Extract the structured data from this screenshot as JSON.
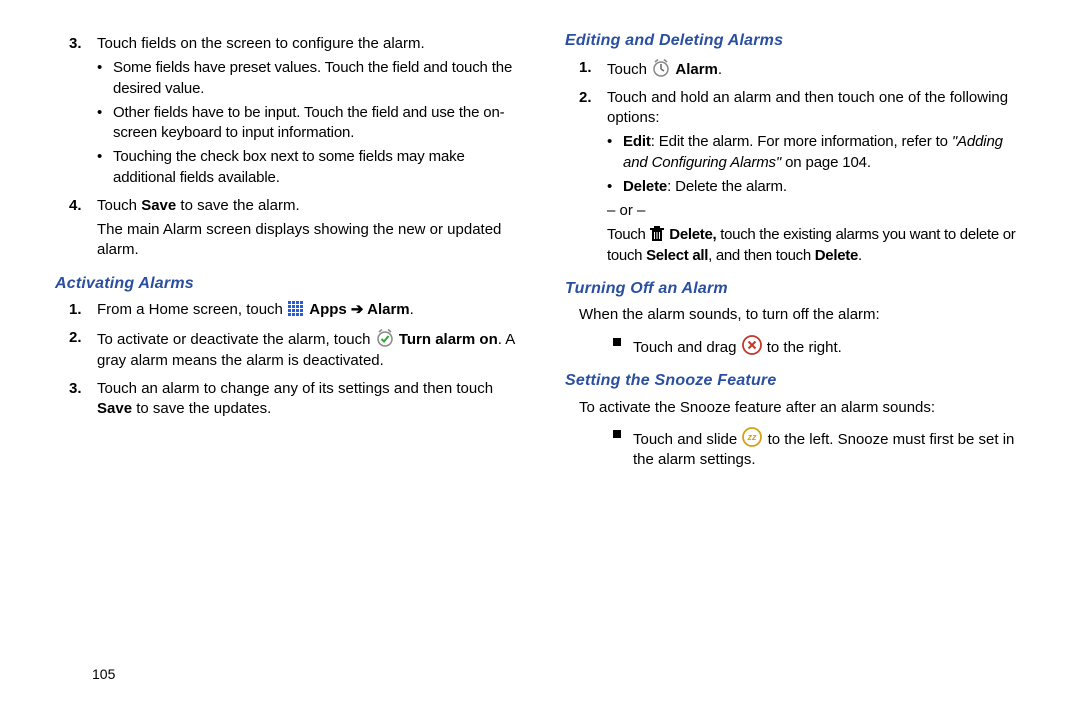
{
  "pageNumber": "105",
  "left": {
    "step3": {
      "num": "3.",
      "text": "Touch fields on the screen to configure the alarm.",
      "bullets": [
        "Some fields have preset values. Touch the field and touch the desired value.",
        "Other fields have to be input. Touch the field and use the on-screen keyboard to input information.",
        "Touching the check box next to some fields may make additional fields available."
      ]
    },
    "step4": {
      "num": "4.",
      "a": "Touch ",
      "save": "Save",
      "b": " to save the alarm.",
      "c": "The main Alarm screen displays showing the new or updated alarm."
    },
    "activating": {
      "heading": "Activating Alarms",
      "s1": {
        "num": "1.",
        "a": "From a Home screen, touch ",
        "apps": " Apps ",
        "arrow": "➔",
        "alarm": " Alarm",
        "dot": "."
      },
      "s2": {
        "num": "2.",
        "a": "To activate or deactivate the alarm, touch ",
        "b1": " Turn alarm on",
        "b2": ". A gray alarm means the alarm is deactivated."
      },
      "s3": {
        "num": "3.",
        "a": "Touch an alarm to change any of its settings and then touch ",
        "save": "Save",
        "b": " to save the updates."
      }
    }
  },
  "right": {
    "editing": {
      "heading": "Editing and Deleting Alarms",
      "s1": {
        "num": "1.",
        "a": "Touch ",
        "alarm": " Alarm",
        "dot": "."
      },
      "s2": {
        "num": "2.",
        "a": "Touch and hold an alarm and then touch one of the following options:",
        "edit": {
          "label": "Edit",
          "a": ": Edit the alarm. For more information, refer to ",
          "ref": "\"Adding and Configuring Alarms\"",
          "b": " on page 104."
        },
        "delete": {
          "label": "Delete",
          "a": ": Delete the alarm."
        },
        "or": "– or –",
        "c1": "Touch  ",
        "c2": " Delete,",
        "c3": " touch the existing alarms you want to delete or touch ",
        "c4": "Select all",
        "c5": ", and then touch ",
        "c6": "Delete",
        "c7": "."
      }
    },
    "turnoff": {
      "heading": "Turning Off an Alarm",
      "intro": "When the alarm sounds, to turn off the alarm:",
      "item": {
        "a": "Touch and drag ",
        "b": " to the right."
      }
    },
    "snooze": {
      "heading": "Setting the Snooze Feature",
      "intro": "To activate the Snooze feature after an alarm sounds:",
      "item": {
        "a": "Touch and slide ",
        "b": " to the left. Snooze must first be set in the alarm settings."
      }
    }
  }
}
